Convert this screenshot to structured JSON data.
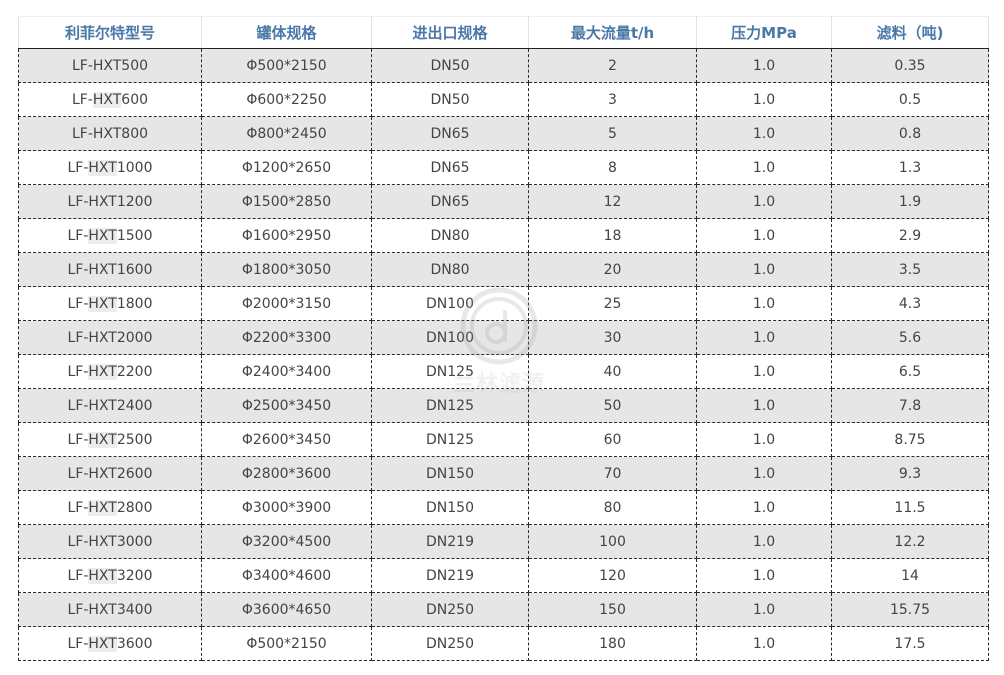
{
  "table": {
    "headers": [
      "利菲尔特型号",
      "罐体规格",
      "进出口规格",
      "最大流量t/h",
      "压力MPa",
      "滤料（吨)"
    ],
    "rows": [
      {
        "model_prefix": "LF-",
        "model_hl": "",
        "model_rest": "HXT500",
        "size": "Φ500*2150",
        "port": "DN50",
        "flow": "2",
        "pressure": "1.0",
        "media": "0.35"
      },
      {
        "model_prefix": "LF-",
        "model_hl": "HXT",
        "model_rest": "600",
        "size": "Φ600*2250",
        "port": "DN50",
        "flow": "3",
        "pressure": "1.0",
        "media": "0.5"
      },
      {
        "model_prefix": "LF-",
        "model_hl": "",
        "model_rest": "HXT800",
        "size": "Φ800*2450",
        "port": "DN65",
        "flow": "5",
        "pressure": "1.0",
        "media": "0.8"
      },
      {
        "model_prefix": "LF-",
        "model_hl": "HXT",
        "model_rest": "1000",
        "size": "Φ1200*2650",
        "port": "DN65",
        "flow": "8",
        "pressure": "1.0",
        "media": "1.3"
      },
      {
        "model_prefix": "LF-",
        "model_hl": "",
        "model_rest": "HXT1200",
        "size": "Φ1500*2850",
        "port": "DN65",
        "flow": "12",
        "pressure": "1.0",
        "media": "1.9"
      },
      {
        "model_prefix": "LF-",
        "model_hl": "HXT",
        "model_rest": "1500",
        "size": "Φ1600*2950",
        "port": "DN80",
        "flow": "18",
        "pressure": "1.0",
        "media": "2.9"
      },
      {
        "model_prefix": "LF-",
        "model_hl": "",
        "model_rest": "HXT1600",
        "size": "Φ1800*3050",
        "port": "DN80",
        "flow": "20",
        "pressure": "1.0",
        "media": "3.5"
      },
      {
        "model_prefix": "LF-",
        "model_hl": "HXT",
        "model_rest": "1800",
        "size": "Φ2000*3150",
        "port": "DN100",
        "flow": "25",
        "pressure": "1.0",
        "media": "4.3"
      },
      {
        "model_prefix": "LF-",
        "model_hl": "",
        "model_rest": "HXT2000",
        "size": "Φ2200*3300",
        "port": "DN100",
        "flow": "30",
        "pressure": "1.0",
        "media": "5.6"
      },
      {
        "model_prefix": "LF-",
        "model_hl": "HXT",
        "model_rest": "2200",
        "size": "Φ2400*3400",
        "port": "DN125",
        "flow": "40",
        "pressure": "1.0",
        "media": "6.5"
      },
      {
        "model_prefix": "LF-",
        "model_hl": "",
        "model_rest": "HXT2400",
        "size": "Φ2500*3450",
        "port": "DN125",
        "flow": "50",
        "pressure": "1.0",
        "media": "7.8"
      },
      {
        "model_prefix": "LF-",
        "model_hl": "HXT",
        "model_rest": "2500",
        "size": "Φ2600*3450",
        "port": "DN125",
        "flow": "60",
        "pressure": "1.0",
        "media": "8.75"
      },
      {
        "model_prefix": "LF-",
        "model_hl": "",
        "model_rest": "HXT2600",
        "size": "Φ2800*3600",
        "port": "DN150",
        "flow": "70",
        "pressure": "1.0",
        "media": "9.3"
      },
      {
        "model_prefix": "LF-",
        "model_hl": "HXT",
        "model_rest": "2800",
        "size": "Φ3000*3900",
        "port": "DN150",
        "flow": "80",
        "pressure": "1.0",
        "media": "11.5"
      },
      {
        "model_prefix": "LF-",
        "model_hl": "",
        "model_rest": "HXT3000",
        "size": "Φ3200*4500",
        "port": "DN219",
        "flow": "100",
        "pressure": "1.0",
        "media": "12.2"
      },
      {
        "model_prefix": "LF-",
        "model_hl": "HXT",
        "model_rest": "3200",
        "size": "Φ3400*4600",
        "port": "DN219",
        "flow": "120",
        "pressure": "1.0",
        "media": "14"
      },
      {
        "model_prefix": "LF-",
        "model_hl": "",
        "model_rest": "HXT3400",
        "size": "Φ3600*4650",
        "port": "DN250",
        "flow": "150",
        "pressure": "1.0",
        "media": "15.75"
      },
      {
        "model_prefix": "LF-",
        "model_hl": "HXT",
        "model_rest": "3600",
        "size": "Φ500*2150",
        "port": "DN250",
        "flow": "180",
        "pressure": "1.0",
        "media": "17.5"
      }
    ]
  },
  "watermark": {
    "text": "兰林滤源"
  },
  "colors": {
    "header_text": "#4a78a8",
    "body_text": "#444444",
    "alt_row_bg": "#e6e6e6",
    "grid_line": "#2a2a2a"
  }
}
